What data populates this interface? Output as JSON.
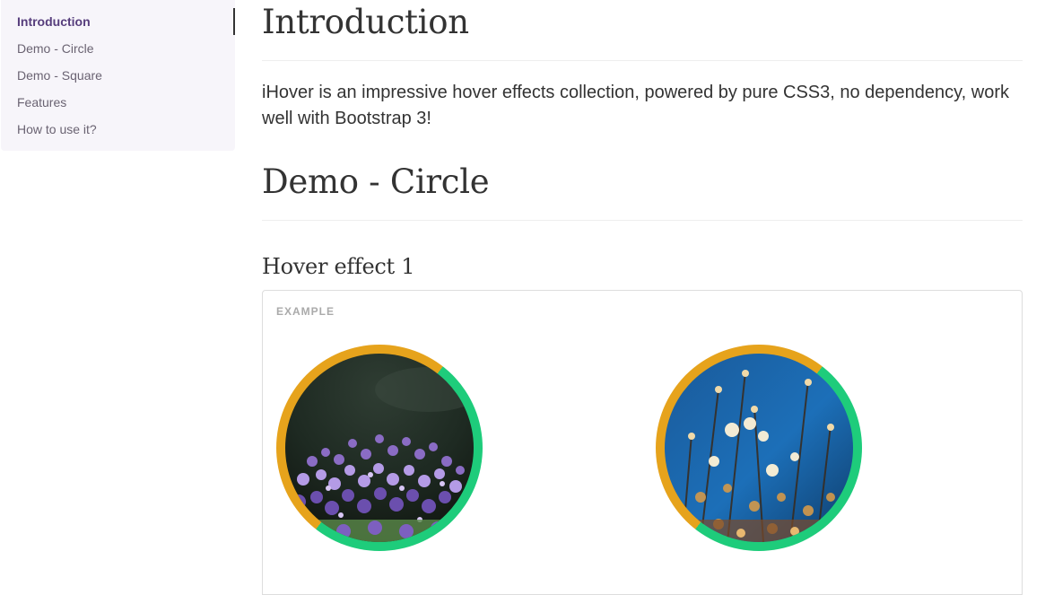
{
  "sidebar": {
    "items": [
      {
        "label": "Introduction",
        "active": true
      },
      {
        "label": "Demo - Circle"
      },
      {
        "label": "Demo - Square"
      },
      {
        "label": "Features"
      },
      {
        "label": "How to use it?"
      }
    ]
  },
  "main": {
    "intro_title": "Introduction",
    "intro_text": "iHover is an impressive hover effects collection, powered by pure CSS3, no dependency, work well with Bootstrap 3!",
    "demo_circle_title": "Demo - Circle",
    "hover_effect_title": "Hover effect 1",
    "example_label": "EXAMPLE"
  },
  "colors": {
    "accent": "#563d7c",
    "ring_orange": "#e6a31c",
    "ring_green": "#1ecc7b"
  }
}
